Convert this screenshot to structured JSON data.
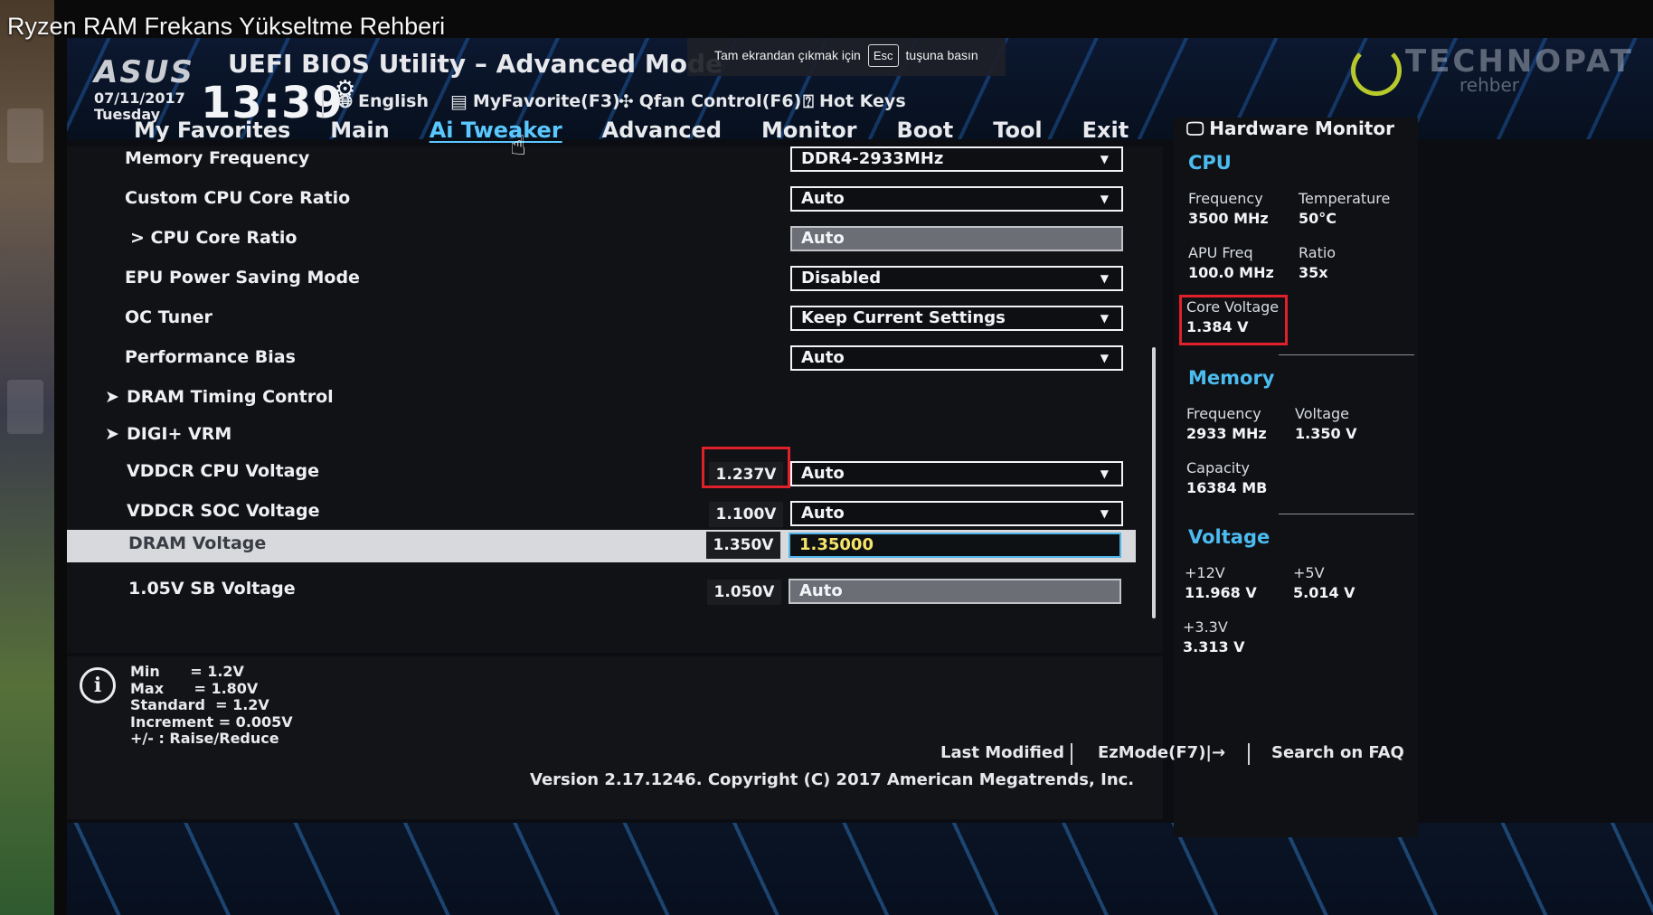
{
  "video_title": "Ryzen RAM Frekans Yükseltme Rehberi",
  "header": {
    "logo": "ASUS",
    "title": "UEFI BIOS Utility – Advanced Mode",
    "esc_tip_before": "Tam ekrandan çıkmak için",
    "esc_key": "Esc",
    "esc_tip_after": "tuşuna basın",
    "date": "07/11/2017",
    "day": "Tuesday",
    "time": "13:39",
    "language": "English",
    "myfavorite": "MyFavorite(F3)",
    "qfan": "Qfan Control(F6)",
    "hotkeys": "Hot Keys",
    "watermark": "TECHNOPAT",
    "watermark_sub": "rehber"
  },
  "tabs": [
    {
      "label": "My Favorites"
    },
    {
      "label": "Main"
    },
    {
      "label": "Ai Tweaker",
      "active": true
    },
    {
      "label": "Advanced"
    },
    {
      "label": "Monitor"
    },
    {
      "label": "Boot"
    },
    {
      "label": "Tool"
    },
    {
      "label": "Exit"
    }
  ],
  "settings": [
    {
      "label": "Memory Frequency",
      "value": "DDR4-2933MHz"
    },
    {
      "label": "Custom CPU Core Ratio",
      "value": "Auto"
    },
    {
      "label": "> CPU Core Ratio",
      "value": "Auto"
    },
    {
      "label": "EPU Power Saving Mode",
      "value": "Disabled"
    },
    {
      "label": "OC Tuner",
      "value": "Keep Current Settings"
    },
    {
      "label": "Performance Bias",
      "value": "Auto"
    },
    {
      "label": "DRAM Timing Control"
    },
    {
      "label": "DIGI+ VRM"
    },
    {
      "label": "VDDCR CPU Voltage",
      "reading": "1.237V",
      "value": "Auto"
    },
    {
      "label": "VDDCR SOC Voltage",
      "reading": "1.100V",
      "value": "Auto"
    },
    {
      "label": "DRAM Voltage",
      "reading": "1.350V",
      "value": "1.35000"
    },
    {
      "label": "1.05V SB Voltage",
      "reading": "1.050V",
      "value": "Auto"
    }
  ],
  "help": {
    "lines": [
      "Min      = 1.2V",
      "Max      = 1.80V",
      "Standard  = 1.2V",
      "Increment = 0.005V",
      "+/- : Raise/Reduce"
    ]
  },
  "hardware_monitor": {
    "title": "Hardware Monitor",
    "cpu": {
      "title": "CPU",
      "frequency_label": "Frequency",
      "frequency": "3500 MHz",
      "temperature_label": "Temperature",
      "temperature": "50°C",
      "apu_label": "APU Freq",
      "apu": "100.0 MHz",
      "ratio_label": "Ratio",
      "ratio": "35x",
      "core_voltage_label": "Core Voltage",
      "core_voltage": "1.384 V"
    },
    "memory": {
      "title": "Memory",
      "frequency_label": "Frequency",
      "frequency": "2933 MHz",
      "voltage_label": "Voltage",
      "voltage": "1.350 V",
      "capacity_label": "Capacity",
      "capacity": "16384 MB"
    },
    "voltage": {
      "title": "Voltage",
      "v12_label": "+12V",
      "v12": "11.968 V",
      "v5_label": "+5V",
      "v5": "5.014 V",
      "v33_label": "+3.3V",
      "v33": "3.313 V"
    }
  },
  "footer": {
    "last_modified": "Last Modified",
    "ezmode": "EzMode(F7)|→",
    "search": "Search on FAQ",
    "version": "Version 2.17.1246. Copyright (C) 2017 American Megatrends, Inc."
  },
  "colors": {
    "accent": "#4cbbf0",
    "highlight_box": "#e0202a",
    "edit_text": "#f6e36a"
  },
  "icons": {
    "globe": "globe-icon",
    "favorite": "favorite-icon",
    "fan": "fan-icon",
    "hotkey": "hotkey-icon",
    "gear": "gear-icon",
    "monitor": "monitor-icon",
    "info": "info-icon"
  }
}
